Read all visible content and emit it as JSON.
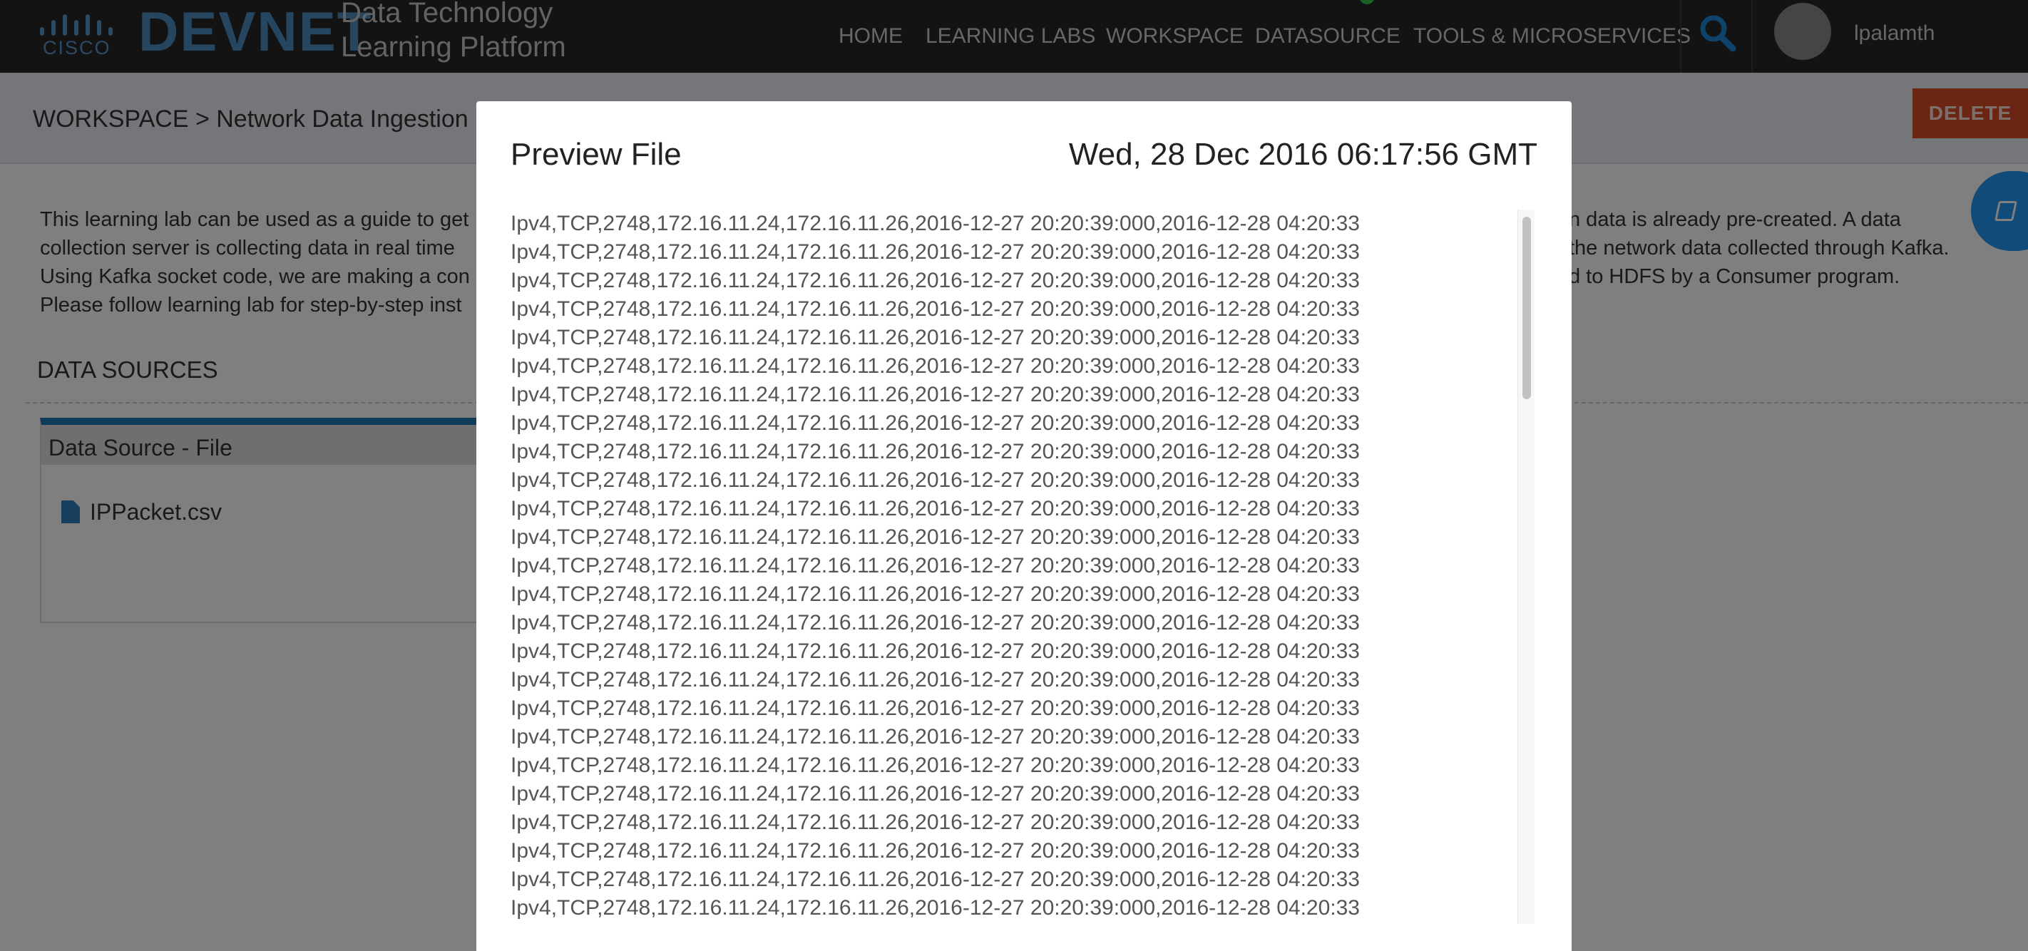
{
  "nav": {
    "logo_text": "CISCO",
    "brand": "DEVNET",
    "platform_line1": "Data Technology",
    "platform_line2": "Learning Platform",
    "items": [
      "HOME",
      "LEARNING LABS",
      "WORKSPACE",
      "DATASOURCE",
      "TOOLS & MICROSERVICES"
    ],
    "search_icon": "search-icon",
    "username": "lpalamth"
  },
  "page": {
    "breadcrumb": "WORKSPACE > Network Data Ingestion",
    "delete_label": "DELETE",
    "intro_left": [
      "This learning lab can be used as a guide to get",
      "collection server is collecting data in real time",
      "Using Kafka socket code, we are making a con",
      "Please follow learning lab for step-by-step inst"
    ],
    "intro_right": [
      "n data is already pre-created. A data",
      "the network data collected through Kafka.",
      "d to HDFS by a Consumer program.",
      ""
    ],
    "data_sources_title": "DATA SOURCES",
    "card_title": "Data Source - File",
    "file_name": "IPPacket.csv",
    "fab_icon": "book-icon"
  },
  "modal": {
    "title": "Preview File",
    "date": "Wed, 28 Dec 2016 06:17:56 GMT",
    "lines": [
      "Ipv4,TCP,2748,172.16.11.24,172.16.11.26,2016-12-27 20:20:39:000,2016-12-28 04:20:33",
      "Ipv4,TCP,2748,172.16.11.24,172.16.11.26,2016-12-27 20:20:39:000,2016-12-28 04:20:33",
      "Ipv4,TCP,2748,172.16.11.24,172.16.11.26,2016-12-27 20:20:39:000,2016-12-28 04:20:33",
      "Ipv4,TCP,2748,172.16.11.24,172.16.11.26,2016-12-27 20:20:39:000,2016-12-28 04:20:33",
      "Ipv4,TCP,2748,172.16.11.24,172.16.11.26,2016-12-27 20:20:39:000,2016-12-28 04:20:33",
      "Ipv4,TCP,2748,172.16.11.24,172.16.11.26,2016-12-27 20:20:39:000,2016-12-28 04:20:33",
      "Ipv4,TCP,2748,172.16.11.24,172.16.11.26,2016-12-27 20:20:39:000,2016-12-28 04:20:33",
      "Ipv4,TCP,2748,172.16.11.24,172.16.11.26,2016-12-27 20:20:39:000,2016-12-28 04:20:33",
      "Ipv4,TCP,2748,172.16.11.24,172.16.11.26,2016-12-27 20:20:39:000,2016-12-28 04:20:33",
      "Ipv4,TCP,2748,172.16.11.24,172.16.11.26,2016-12-27 20:20:39:000,2016-12-28 04:20:33",
      "Ipv4,TCP,2748,172.16.11.24,172.16.11.26,2016-12-27 20:20:39:000,2016-12-28 04:20:33",
      "Ipv4,TCP,2748,172.16.11.24,172.16.11.26,2016-12-27 20:20:39:000,2016-12-28 04:20:33",
      "Ipv4,TCP,2748,172.16.11.24,172.16.11.26,2016-12-27 20:20:39:000,2016-12-28 04:20:33",
      "Ipv4,TCP,2748,172.16.11.24,172.16.11.26,2016-12-27 20:20:39:000,2016-12-28 04:20:33",
      "Ipv4,TCP,2748,172.16.11.24,172.16.11.26,2016-12-27 20:20:39:000,2016-12-28 04:20:33",
      "Ipv4,TCP,2748,172.16.11.24,172.16.11.26,2016-12-27 20:20:39:000,2016-12-28 04:20:33",
      "Ipv4,TCP,2748,172.16.11.24,172.16.11.26,2016-12-27 20:20:39:000,2016-12-28 04:20:33",
      "Ipv4,TCP,2748,172.16.11.24,172.16.11.26,2016-12-27 20:20:39:000,2016-12-28 04:20:33",
      "Ipv4,TCP,2748,172.16.11.24,172.16.11.26,2016-12-27 20:20:39:000,2016-12-28 04:20:33",
      "Ipv4,TCP,2748,172.16.11.24,172.16.11.26,2016-12-27 20:20:39:000,2016-12-28 04:20:33",
      "Ipv4,TCP,2748,172.16.11.24,172.16.11.26,2016-12-27 20:20:39:000,2016-12-28 04:20:33",
      "Ipv4,TCP,2748,172.16.11.24,172.16.11.26,2016-12-27 20:20:39:000,2016-12-28 04:20:33",
      "Ipv4,TCP,2748,172.16.11.24,172.16.11.26,2016-12-27 20:20:39:000,2016-12-28 04:20:33",
      "Ipv4,TCP,2748,172.16.11.24,172.16.11.26,2016-12-27 20:20:39:000,2016-12-28 04:20:33",
      "Ipv4,TCP,2748,172.16.11.24,172.16.11.26,2016-12-27 20:20:39:000,2016-12-28 04:20:33"
    ]
  }
}
